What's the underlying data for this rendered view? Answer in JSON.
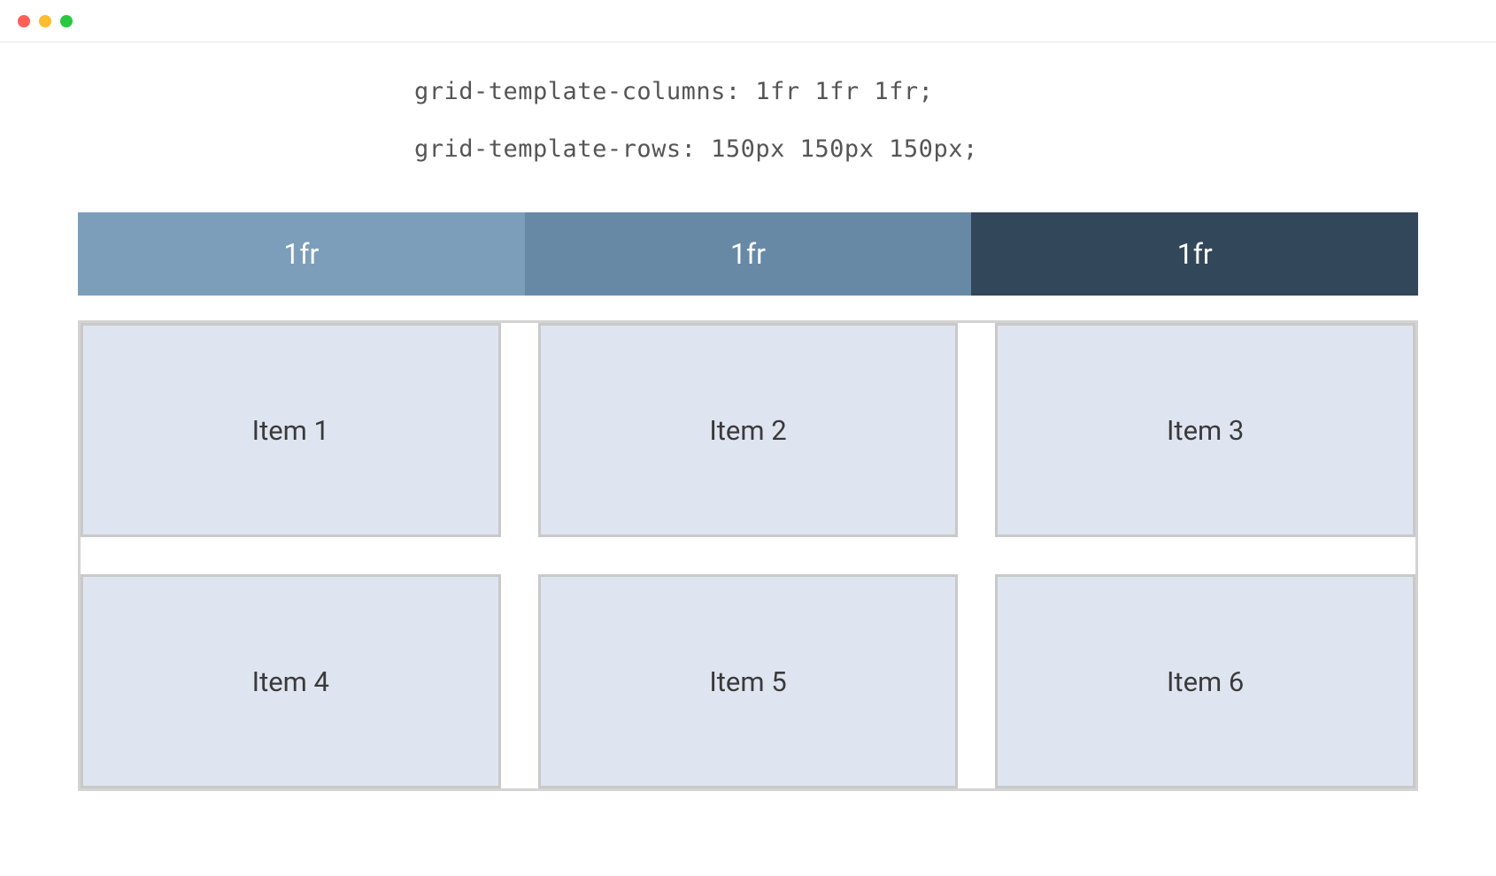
{
  "code": {
    "line1": "grid-template-columns: 1fr 1fr 1fr;",
    "line2": "grid-template-rows: 150px 150px 150px;"
  },
  "header": {
    "col1": "1fr",
    "col2": "1fr",
    "col3": "1fr"
  },
  "items": {
    "i1": "Item 1",
    "i2": "Item 2",
    "i3": "Item 3",
    "i4": "Item 4",
    "i5": "Item 5",
    "i6": "Item 6"
  }
}
